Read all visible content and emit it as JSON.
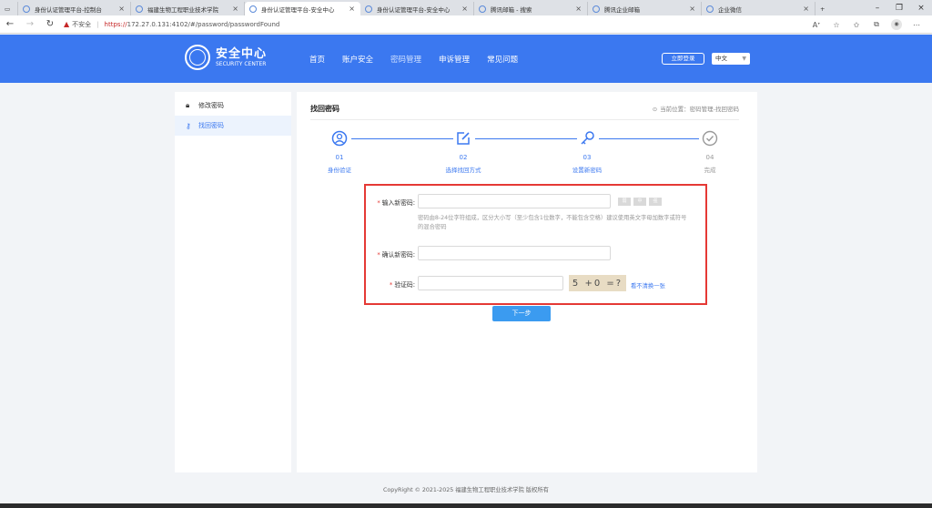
{
  "browser": {
    "tabs": [
      {
        "label": "身份认证管理平台-控制台",
        "active": false
      },
      {
        "label": "福建生物工程职业技术学院",
        "active": false
      },
      {
        "label": "身份认证管理平台-安全中心",
        "active": true
      },
      {
        "label": "身份认证管理平台-安全中心",
        "active": false
      },
      {
        "label": "腾讯邮箱 - 搜索",
        "active": false
      },
      {
        "label": "腾讯企业邮箱",
        "active": false
      },
      {
        "label": "企业微信",
        "active": false
      }
    ],
    "url_insecure": "不安全",
    "url_scheme": "https://",
    "url_rest": "172.27.0.131:4102/#/password/passwordFound"
  },
  "header": {
    "logo_cn": "安全中心",
    "logo_en": "SECURITY CENTER",
    "nav": [
      {
        "label": "首页",
        "current": false
      },
      {
        "label": "账户安全",
        "current": false
      },
      {
        "label": "密码管理",
        "current": true
      },
      {
        "label": "申诉管理",
        "current": false
      },
      {
        "label": "常见问题",
        "current": false
      }
    ],
    "login_label": "立即登录",
    "lang": "中文"
  },
  "sidebar": {
    "items": [
      {
        "label": "修改密码",
        "icon": "lock-icon",
        "active": false
      },
      {
        "label": "找回密码",
        "icon": "key-icon",
        "active": true
      }
    ]
  },
  "main": {
    "title": "找回密码",
    "breadcrumb": "当前位置：密码管理-找回密码",
    "steps": [
      {
        "num": "01",
        "label": "身份验证",
        "done": true
      },
      {
        "num": "02",
        "label": "选择找回方式",
        "done": true
      },
      {
        "num": "03",
        "label": "设置新密码",
        "done": true
      },
      {
        "num": "04",
        "label": "完成",
        "done": false
      }
    ],
    "form": {
      "new_password_label": "输入新密码:",
      "new_password_value": "",
      "strength": [
        "弱",
        "中",
        "强"
      ],
      "hint": "密码由8-24位字符组成，区分大小写（至少包含1位数字，不能包含空格）建议使用英文字母加数字或符号的混合密码",
      "confirm_label": "确认新密码:",
      "confirm_value": "",
      "captcha_label": "验证码:",
      "captcha_value": "",
      "captcha_text": "5 +0 =?",
      "captcha_refresh": "看不清换一张"
    },
    "next_label": "下一步"
  },
  "footer": {
    "text": "CopyRight © 2021-2025 福建生物工程职业技术学院 版权所有"
  },
  "colors": {
    "brand": "#3b78f0",
    "error_border": "#e53935",
    "button": "#3b9bf0"
  }
}
